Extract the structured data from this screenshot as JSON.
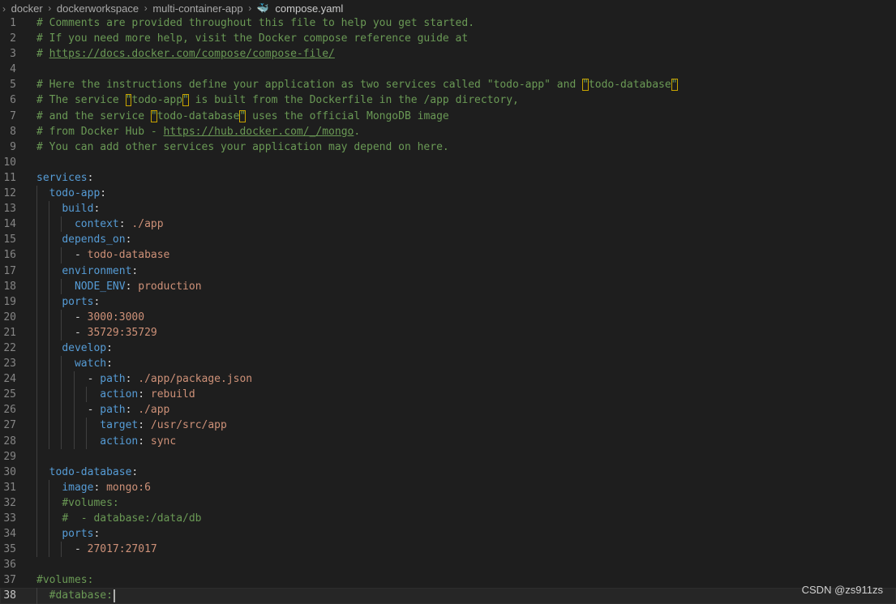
{
  "breadcrumb": {
    "items": [
      "docker",
      "dockerworkspace",
      "multi-container-app"
    ],
    "file_icon": "docker-compose-file-icon",
    "file": "compose.yaml"
  },
  "editor": {
    "active_line": 38,
    "lines": [
      {
        "num": "1",
        "segs": [
          [
            "c",
            "# Comments are provided throughout this file to help you get started."
          ]
        ]
      },
      {
        "num": "2",
        "segs": [
          [
            "c",
            "# If you need more help, visit the Docker compose reference guide at"
          ]
        ]
      },
      {
        "num": "3",
        "segs": [
          [
            "c",
            "# "
          ],
          [
            "c u",
            "https://docs.docker.com/compose/compose-file/"
          ]
        ]
      },
      {
        "num": "4",
        "segs": []
      },
      {
        "num": "5",
        "segs": [
          [
            "c",
            "# Here the instructions define your application as two services called \"todo-app\" and "
          ],
          [
            "c hl",
            "\""
          ],
          [
            "c",
            "todo-database"
          ],
          [
            "c hl",
            "\""
          ]
        ]
      },
      {
        "num": "6",
        "segs": [
          [
            "c",
            "# The service "
          ],
          [
            "c hl",
            "\""
          ],
          [
            "c",
            "todo-app"
          ],
          [
            "c hl",
            "\""
          ],
          [
            "c",
            " is built from the Dockerfile in the /app directory,"
          ]
        ]
      },
      {
        "num": "7",
        "segs": [
          [
            "c",
            "# and the service "
          ],
          [
            "c hl",
            "\""
          ],
          [
            "c",
            "todo-database"
          ],
          [
            "c hl",
            "\""
          ],
          [
            "c",
            " uses the official MongoDB image"
          ]
        ]
      },
      {
        "num": "8",
        "segs": [
          [
            "c",
            "# from Docker Hub - "
          ],
          [
            "c u",
            "https://hub.docker.com/_/mongo"
          ],
          [
            "c",
            "."
          ]
        ]
      },
      {
        "num": "9",
        "segs": [
          [
            "c",
            "# You can add other services your application may depend on here."
          ]
        ]
      },
      {
        "num": "10",
        "segs": []
      },
      {
        "num": "11",
        "segs": [
          [
            "k",
            "services"
          ],
          [
            "p",
            ":"
          ]
        ]
      },
      {
        "num": "12",
        "guides": 1,
        "segs": [
          [
            "p",
            "  "
          ],
          [
            "k",
            "todo-app"
          ],
          [
            "p",
            ":"
          ]
        ]
      },
      {
        "num": "13",
        "guides": 2,
        "segs": [
          [
            "p",
            "    "
          ],
          [
            "k",
            "build"
          ],
          [
            "p",
            ":"
          ]
        ]
      },
      {
        "num": "14",
        "guides": 3,
        "segs": [
          [
            "p",
            "      "
          ],
          [
            "k",
            "context"
          ],
          [
            "p",
            ": "
          ],
          [
            "v",
            "./app"
          ]
        ]
      },
      {
        "num": "15",
        "guides": 2,
        "segs": [
          [
            "p",
            "    "
          ],
          [
            "k",
            "depends_on"
          ],
          [
            "p",
            ":"
          ]
        ]
      },
      {
        "num": "16",
        "guides": 3,
        "segs": [
          [
            "p",
            "      - "
          ],
          [
            "v",
            "todo-database"
          ]
        ]
      },
      {
        "num": "17",
        "guides": 2,
        "segs": [
          [
            "p",
            "    "
          ],
          [
            "k",
            "environment"
          ],
          [
            "p",
            ":"
          ]
        ]
      },
      {
        "num": "18",
        "guides": 3,
        "segs": [
          [
            "p",
            "      "
          ],
          [
            "k",
            "NODE_ENV"
          ],
          [
            "p",
            ": "
          ],
          [
            "v",
            "production"
          ]
        ]
      },
      {
        "num": "19",
        "guides": 2,
        "segs": [
          [
            "p",
            "    "
          ],
          [
            "k",
            "ports"
          ],
          [
            "p",
            ":"
          ]
        ]
      },
      {
        "num": "20",
        "guides": 3,
        "segs": [
          [
            "p",
            "      - "
          ],
          [
            "v",
            "3000:3000"
          ]
        ]
      },
      {
        "num": "21",
        "guides": 3,
        "segs": [
          [
            "p",
            "      - "
          ],
          [
            "v",
            "35729:35729"
          ]
        ]
      },
      {
        "num": "22",
        "guides": 2,
        "segs": [
          [
            "p",
            "    "
          ],
          [
            "k",
            "develop"
          ],
          [
            "p",
            ":"
          ]
        ]
      },
      {
        "num": "23",
        "guides": 3,
        "segs": [
          [
            "p",
            "      "
          ],
          [
            "k",
            "watch"
          ],
          [
            "p",
            ":"
          ]
        ]
      },
      {
        "num": "24",
        "guides": 4,
        "segs": [
          [
            "p",
            "        - "
          ],
          [
            "k",
            "path"
          ],
          [
            "p",
            ": "
          ],
          [
            "v",
            "./app/package.json"
          ]
        ]
      },
      {
        "num": "25",
        "guides": 5,
        "segs": [
          [
            "p",
            "          "
          ],
          [
            "k",
            "action"
          ],
          [
            "p",
            ": "
          ],
          [
            "v",
            "rebuild"
          ]
        ]
      },
      {
        "num": "26",
        "guides": 4,
        "segs": [
          [
            "p",
            "        - "
          ],
          [
            "k",
            "path"
          ],
          [
            "p",
            ": "
          ],
          [
            "v",
            "./app"
          ]
        ]
      },
      {
        "num": "27",
        "guides": 5,
        "segs": [
          [
            "p",
            "          "
          ],
          [
            "k",
            "target"
          ],
          [
            "p",
            ": "
          ],
          [
            "v",
            "/usr/src/app"
          ]
        ]
      },
      {
        "num": "28",
        "guides": 5,
        "segs": [
          [
            "p",
            "          "
          ],
          [
            "k",
            "action"
          ],
          [
            "p",
            ": "
          ],
          [
            "v",
            "sync"
          ]
        ]
      },
      {
        "num": "29",
        "guides": 1,
        "segs": []
      },
      {
        "num": "30",
        "guides": 1,
        "segs": [
          [
            "p",
            "  "
          ],
          [
            "k",
            "todo-database"
          ],
          [
            "p",
            ":"
          ]
        ]
      },
      {
        "num": "31",
        "guides": 2,
        "segs": [
          [
            "p",
            "    "
          ],
          [
            "k",
            "image"
          ],
          [
            "p",
            ": "
          ],
          [
            "v",
            "mongo:6"
          ]
        ]
      },
      {
        "num": "32",
        "guides": 2,
        "segs": [
          [
            "p",
            "    "
          ],
          [
            "c",
            "#volumes:"
          ]
        ]
      },
      {
        "num": "33",
        "guides": 2,
        "segs": [
          [
            "p",
            "    "
          ],
          [
            "c",
            "#  - database:/data/db"
          ]
        ]
      },
      {
        "num": "34",
        "guides": 2,
        "segs": [
          [
            "p",
            "    "
          ],
          [
            "k",
            "ports"
          ],
          [
            "p",
            ":"
          ]
        ]
      },
      {
        "num": "35",
        "guides": 3,
        "segs": [
          [
            "p",
            "      - "
          ],
          [
            "v",
            "27017:27017"
          ]
        ]
      },
      {
        "num": "36",
        "segs": []
      },
      {
        "num": "37",
        "segs": [
          [
            "c",
            "#volumes:"
          ]
        ]
      },
      {
        "num": "38",
        "guides": 1,
        "segs": [
          [
            "p",
            "  "
          ],
          [
            "c",
            "#database:"
          ]
        ]
      }
    ]
  },
  "watermark": "CSDN @zs911zs"
}
